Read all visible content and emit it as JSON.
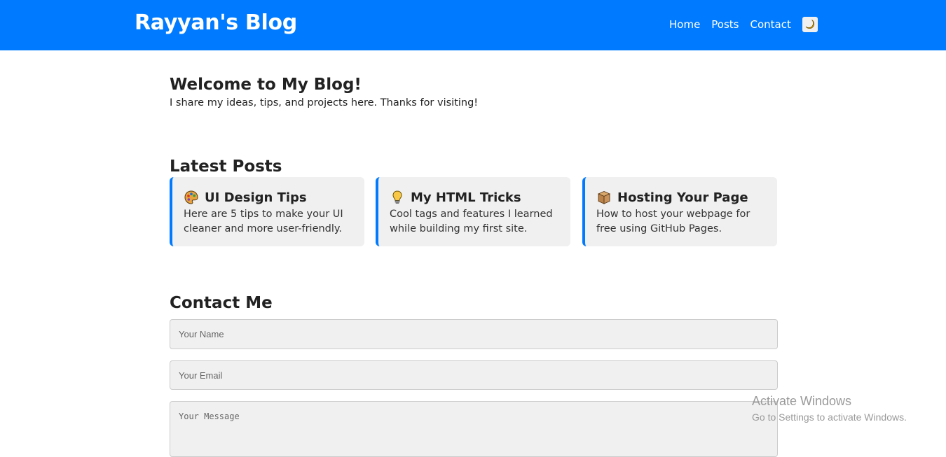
{
  "header": {
    "brand": "Rayyan's Blog",
    "nav": [
      "Home",
      "Posts",
      "Contact"
    ],
    "theme_toggle_icon": "crescent-moon-icon",
    "background_color": "#007bff"
  },
  "hero": {
    "title": "Welcome to My Blog!",
    "subtitle": "I share my ideas, tips, and projects here. Thanks for visiting!"
  },
  "posts": {
    "title": "Latest Posts",
    "items": [
      {
        "icon": "artist-palette-icon",
        "title": "UI Design Tips",
        "excerpt": "Here are 5 tips to make your UI cleaner and more user-friendly."
      },
      {
        "icon": "light-bulb-icon",
        "title": "My HTML Tricks",
        "excerpt": "Cool tags and features I learned while building my first site."
      },
      {
        "icon": "package-box-icon",
        "title": "Hosting Your Page",
        "excerpt": "How to host your webpage for free using GitHub Pages."
      }
    ]
  },
  "contact": {
    "title": "Contact Me",
    "name_placeholder": "Your Name",
    "email_placeholder": "Your Email",
    "message_placeholder": "Your Message"
  },
  "watermark": {
    "line1": "Activate Windows",
    "line2": "Go to Settings to activate Windows."
  }
}
